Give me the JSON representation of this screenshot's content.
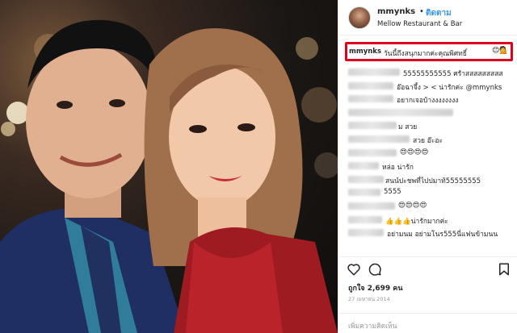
{
  "post": {
    "username": "mmynks",
    "separator": "•",
    "follow_label": "ติดตาม",
    "location": "Mellow Restaurant & Bar",
    "caption_user": "mmynks",
    "caption_text": "วันนี้ถึงสนุกมากค่ะคุณพิศทธิ์",
    "caption_emoji": "😊💁"
  },
  "comments": [
    {
      "text": "55555555555 ศรัาสสสสสสสสส"
    },
    {
      "text": "อ๊อฉาจึ้ง > < น่ารักค่ะ @mmynks"
    },
    {
      "text": "อยากเจอบ้างงงงงงงง"
    },
    {
      "text": ""
    },
    {
      "text": "ม สวย"
    },
    {
      "text": "สวย อ๊ะอะ"
    },
    {
      "text": "😍😍😍😍"
    },
    {
      "text": "หล่อ น่ารัก"
    },
    {
      "text": "สนน์ปะชพที่ไปปมาท้55555555"
    },
    {
      "text": "5555"
    },
    {
      "text": "😍😍😍😍"
    },
    {
      "text": "👍👍👍น่ารักมากค่ะ"
    },
    {
      "text": "อย่ามนม อย่ามโนร555นี่แฟนข้ามนน"
    }
  ],
  "actions": {
    "like_icon": "heart-icon",
    "comment_icon": "comment-icon",
    "save_icon": "bookmark-icon"
  },
  "likes": "ถูกใจ 2,699 คน",
  "date": "27 เมษายน 2014",
  "add_comment_placeholder": "เพิ่มความคิดเห็น"
}
